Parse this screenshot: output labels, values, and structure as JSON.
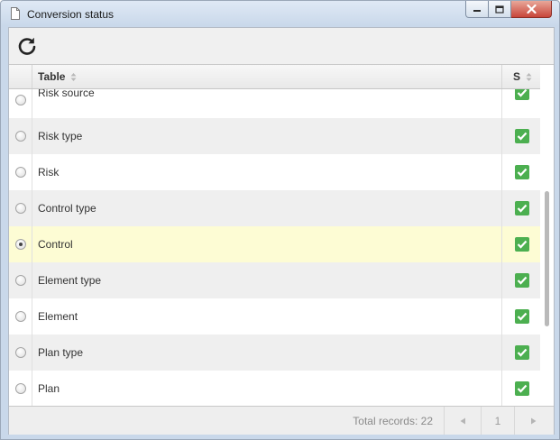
{
  "window": {
    "title": "Conversion status",
    "page_icon": "document-icon",
    "controls": [
      "minimize-icon",
      "maximize-icon",
      "close-icon"
    ]
  },
  "toolbar": {
    "refresh_icon": "refresh-icon"
  },
  "grid": {
    "columns": [
      {
        "key": "table",
        "label": "Table",
        "sortable": true
      },
      {
        "key": "status",
        "label": "S",
        "sortable": true
      }
    ],
    "rows": [
      {
        "name": "Risk source",
        "selected": false,
        "status": "done"
      },
      {
        "name": "Risk type",
        "selected": false,
        "status": "done"
      },
      {
        "name": "Risk",
        "selected": false,
        "status": "done"
      },
      {
        "name": "Control type",
        "selected": false,
        "status": "done"
      },
      {
        "name": "Control",
        "selected": true,
        "status": "done"
      },
      {
        "name": "Element type",
        "selected": false,
        "status": "done"
      },
      {
        "name": "Element",
        "selected": false,
        "status": "done"
      },
      {
        "name": "Plan type",
        "selected": false,
        "status": "done"
      },
      {
        "name": "Plan",
        "selected": false,
        "status": "done"
      }
    ]
  },
  "footer": {
    "total_records": "Total records: 22",
    "page": "1",
    "prev_icon": "prev-page-icon",
    "next_icon": "next-page-icon"
  },
  "colors": {
    "status_ok": "#4caf50",
    "selected_row": "#fdfcd4",
    "alt_row": "#efefef"
  }
}
